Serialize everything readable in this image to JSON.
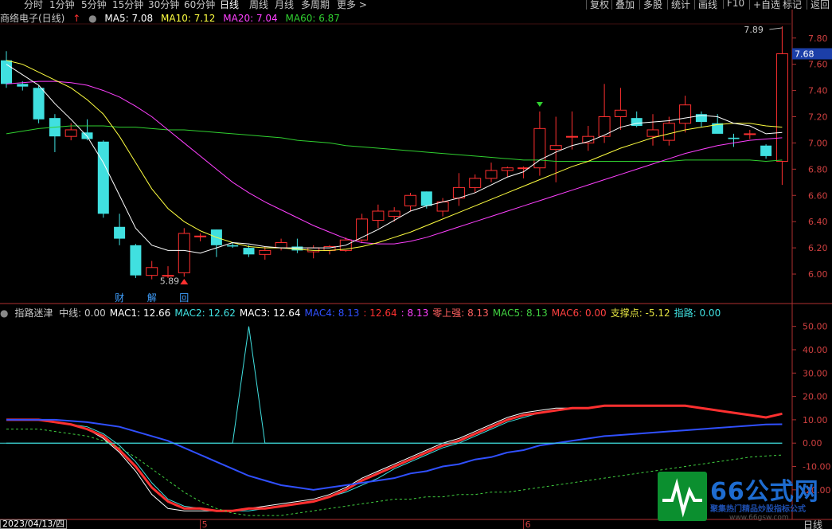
{
  "period_tabs": [
    {
      "label": "分时",
      "x": 30
    },
    {
      "label": "1分钟",
      "x": 62
    },
    {
      "label": "5分钟",
      "x": 102
    },
    {
      "label": "15分钟",
      "x": 141
    },
    {
      "label": "30分钟",
      "x": 186
    },
    {
      "label": "60分钟",
      "x": 231
    },
    {
      "label": "日线",
      "x": 276,
      "active": true
    },
    {
      "label": "周线",
      "x": 313
    },
    {
      "label": "月线",
      "x": 345
    },
    {
      "label": "多周期",
      "x": 378
    },
    {
      "label": "更多 >",
      "x": 423
    }
  ],
  "right_tools": [
    {
      "label": "复权",
      "x": 736
    },
    {
      "label": "叠加",
      "x": 768
    },
    {
      "label": "多股",
      "x": 803
    },
    {
      "label": "统计",
      "x": 838
    },
    {
      "label": "画线",
      "x": 872
    },
    {
      "label": "F10",
      "x": 908
    },
    {
      "label": "+自选",
      "x": 941
    },
    {
      "label": "标记",
      "x": 978
    },
    {
      "label": "返回",
      "x": 1013
    }
  ],
  "main_header": {
    "stock": "商络电子(日线)",
    "ma5": "MA5: 7.08",
    "ma10": "MA10: 7.12",
    "ma20": "MA20: 7.04",
    "ma60": "MA60: 6.87"
  },
  "sub_header": {
    "name": "指路迷津",
    "items": [
      {
        "text": "中线: 0.00",
        "color": "#c8c8c8"
      },
      {
        "text": "MAC1: 12.66",
        "color": "#ffffff"
      },
      {
        "text": "MAC2: 12.62",
        "color": "#40e0e0"
      },
      {
        "text": "MAC3: 12.64",
        "color": "#ffffff"
      },
      {
        "text": "MAC4: 8.13",
        "color": "#3050ff"
      },
      {
        "text": ": 12.64",
        "color": "#ff3030"
      },
      {
        "text": ": 8.13",
        "color": "#ff40ff"
      },
      {
        "text": "零上强: 8.13",
        "color": "#ff6060"
      },
      {
        "text": "MAC5: 8.13",
        "color": "#40d040"
      },
      {
        "text": "MAC6: 0.00",
        "color": "#ff4040"
      },
      {
        "text": "支撑点: -5.12",
        "color": "#e0e040"
      },
      {
        "text": "指路: 0.00",
        "color": "#40e0e0"
      }
    ]
  },
  "colors": {
    "up": "#ff3030",
    "down": "#40e0e0",
    "ma5": "#ffffff",
    "ma10": "#ffff40",
    "ma20": "#ff40ff",
    "ma60": "#30d030",
    "axis": "#b03030"
  },
  "chart_data": [
    {
      "type": "candlestick",
      "title": "商络电子(日线)",
      "y_ticks": [
        "7.80",
        "7.60",
        "7.40",
        "7.20",
        "7.00",
        "6.80",
        "6.60",
        "6.40",
        "6.20",
        "6.00"
      ],
      "ylim": [
        5.83,
        7.92
      ],
      "current_price": "7.68",
      "high_label": "7.89",
      "low_label": "5.89",
      "candles": [
        {
          "o": 7.63,
          "h": 7.7,
          "l": 7.42,
          "c": 7.45
        },
        {
          "o": 7.45,
          "h": 7.47,
          "l": 7.4,
          "c": 7.43
        },
        {
          "o": 7.42,
          "h": 7.44,
          "l": 7.15,
          "c": 7.18
        },
        {
          "o": 7.19,
          "h": 7.22,
          "l": 6.93,
          "c": 7.05
        },
        {
          "o": 7.05,
          "h": 7.15,
          "l": 7.02,
          "c": 7.1
        },
        {
          "o": 7.08,
          "h": 7.18,
          "l": 7.02,
          "c": 7.03
        },
        {
          "o": 7.01,
          "h": 7.02,
          "l": 6.43,
          "c": 6.46
        },
        {
          "o": 6.36,
          "h": 6.46,
          "l": 6.22,
          "c": 6.27
        },
        {
          "o": 6.22,
          "h": 6.23,
          "l": 5.97,
          "c": 5.99
        },
        {
          "o": 5.99,
          "h": 6.1,
          "l": 5.96,
          "c": 6.05
        },
        {
          "o": 5.99,
          "h": 6.06,
          "l": 5.97,
          "c": 5.99
        },
        {
          "o": 6.01,
          "h": 6.35,
          "l": 5.98,
          "c": 6.31
        },
        {
          "o": 6.29,
          "h": 6.31,
          "l": 6.25,
          "c": 6.29
        },
        {
          "o": 6.34,
          "h": 6.34,
          "l": 6.13,
          "c": 6.22
        },
        {
          "o": 6.22,
          "h": 6.24,
          "l": 6.2,
          "c": 6.21
        },
        {
          "o": 6.2,
          "h": 6.22,
          "l": 6.13,
          "c": 6.15
        },
        {
          "o": 6.15,
          "h": 6.21,
          "l": 6.11,
          "c": 6.18
        },
        {
          "o": 6.2,
          "h": 6.27,
          "l": 6.18,
          "c": 6.24
        },
        {
          "o": 6.21,
          "h": 6.27,
          "l": 6.16,
          "c": 6.18
        },
        {
          "o": 6.17,
          "h": 6.22,
          "l": 6.12,
          "c": 6.2
        },
        {
          "o": 6.18,
          "h": 6.22,
          "l": 6.15,
          "c": 6.21
        },
        {
          "o": 6.18,
          "h": 6.28,
          "l": 6.17,
          "c": 6.26
        },
        {
          "o": 6.26,
          "h": 6.46,
          "l": 6.24,
          "c": 6.42
        },
        {
          "o": 6.41,
          "h": 6.53,
          "l": 6.35,
          "c": 6.48
        },
        {
          "o": 6.44,
          "h": 6.51,
          "l": 6.4,
          "c": 6.48
        },
        {
          "o": 6.52,
          "h": 6.62,
          "l": 6.48,
          "c": 6.6
        },
        {
          "o": 6.63,
          "h": 6.63,
          "l": 6.5,
          "c": 6.52
        },
        {
          "o": 6.48,
          "h": 6.58,
          "l": 6.44,
          "c": 6.55
        },
        {
          "o": 6.58,
          "h": 6.77,
          "l": 6.52,
          "c": 6.66
        },
        {
          "o": 6.66,
          "h": 6.76,
          "l": 6.62,
          "c": 6.73
        },
        {
          "o": 6.73,
          "h": 6.85,
          "l": 6.7,
          "c": 6.79
        },
        {
          "o": 6.79,
          "h": 6.82,
          "l": 6.74,
          "c": 6.81
        },
        {
          "o": 6.81,
          "h": 6.82,
          "l": 6.73,
          "c": 6.81
        },
        {
          "o": 6.81,
          "h": 7.24,
          "l": 6.75,
          "c": 7.11
        },
        {
          "o": 6.95,
          "h": 7.2,
          "l": 6.7,
          "c": 6.98
        },
        {
          "o": 7.05,
          "h": 7.24,
          "l": 6.95,
          "c": 7.05
        },
        {
          "o": 7.0,
          "h": 7.13,
          "l": 6.94,
          "c": 7.05
        },
        {
          "o": 7.05,
          "h": 7.45,
          "l": 7.0,
          "c": 7.2
        },
        {
          "o": 7.2,
          "h": 7.42,
          "l": 7.1,
          "c": 7.25
        },
        {
          "o": 7.19,
          "h": 7.24,
          "l": 7.12,
          "c": 7.13
        },
        {
          "o": 7.05,
          "h": 7.22,
          "l": 6.98,
          "c": 7.1
        },
        {
          "o": 7.02,
          "h": 7.2,
          "l": 6.98,
          "c": 7.15
        },
        {
          "o": 7.15,
          "h": 7.36,
          "l": 7.08,
          "c": 7.29
        },
        {
          "o": 7.22,
          "h": 7.24,
          "l": 7.12,
          "c": 7.16
        },
        {
          "o": 7.15,
          "h": 7.22,
          "l": 7.08,
          "c": 7.07
        },
        {
          "o": 7.04,
          "h": 7.07,
          "l": 6.97,
          "c": 7.03
        },
        {
          "o": 7.07,
          "h": 7.1,
          "l": 7.03,
          "c": 7.07
        },
        {
          "o": 6.98,
          "h": 6.99,
          "l": 6.88,
          "c": 6.9
        },
        {
          "o": 6.86,
          "h": 7.89,
          "l": 6.68,
          "c": 7.68
        }
      ],
      "ma5": [
        7.6,
        7.52,
        7.44,
        7.3,
        7.18,
        7.05,
        6.85,
        6.6,
        6.35,
        6.22,
        6.18,
        6.18,
        6.16,
        6.2,
        6.24,
        6.23,
        6.21,
        6.2,
        6.2,
        6.2,
        6.2,
        6.22,
        6.28,
        6.34,
        6.41,
        6.48,
        6.52,
        6.55,
        6.58,
        6.62,
        6.68,
        6.74,
        6.78,
        6.87,
        6.93,
        6.98,
        7.01,
        7.06,
        7.12,
        7.15,
        7.16,
        7.17,
        7.19,
        7.21,
        7.2,
        7.15,
        7.13,
        7.07,
        7.08
      ],
      "ma10": [
        7.63,
        7.6,
        7.54,
        7.48,
        7.42,
        7.33,
        7.22,
        7.05,
        6.85,
        6.65,
        6.5,
        6.4,
        6.33,
        6.28,
        6.24,
        6.21,
        6.2,
        6.2,
        6.19,
        6.18,
        6.18,
        6.19,
        6.21,
        6.24,
        6.28,
        6.32,
        6.37,
        6.42,
        6.47,
        6.52,
        6.57,
        6.62,
        6.67,
        6.72,
        6.77,
        6.82,
        6.86,
        6.91,
        6.96,
        7.0,
        7.04,
        7.07,
        7.1,
        7.12,
        7.14,
        7.15,
        7.15,
        7.13,
        7.12
      ],
      "ma20": [
        7.45,
        7.46,
        7.47,
        7.47,
        7.46,
        7.44,
        7.4,
        7.35,
        7.28,
        7.2,
        7.1,
        7.0,
        6.9,
        6.8,
        6.7,
        6.62,
        6.55,
        6.49,
        6.43,
        6.37,
        6.32,
        6.27,
        6.24,
        6.23,
        6.23,
        6.25,
        6.28,
        6.32,
        6.36,
        6.4,
        6.44,
        6.48,
        6.52,
        6.56,
        6.6,
        6.64,
        6.68,
        6.72,
        6.76,
        6.8,
        6.84,
        6.88,
        6.92,
        6.95,
        6.98,
        7.0,
        7.02,
        7.03,
        7.04
      ],
      "ma60": [
        7.07,
        7.09,
        7.11,
        7.12,
        7.13,
        7.13,
        7.13,
        7.12,
        7.12,
        7.11,
        7.1,
        7.1,
        7.09,
        7.08,
        7.07,
        7.06,
        7.05,
        7.04,
        7.02,
        7.01,
        7.0,
        6.98,
        6.97,
        6.96,
        6.95,
        6.94,
        6.93,
        6.92,
        6.91,
        6.9,
        6.89,
        6.88,
        6.87,
        6.87,
        6.86,
        6.86,
        6.86,
        6.86,
        6.86,
        6.86,
        6.86,
        6.86,
        6.87,
        6.87,
        6.87,
        6.87,
        6.87,
        6.86,
        6.87
      ],
      "markers": [
        {
          "label": "财",
          "index": 7
        },
        {
          "label": "解",
          "index": 9
        },
        {
          "label": "回",
          "index": 11
        }
      ]
    },
    {
      "type": "line",
      "title": "指路迷津",
      "y_ticks": [
        "50.00",
        "40.00",
        "30.00",
        "20.00",
        "10.00",
        "0.00",
        "-10.00",
        "-20.00"
      ],
      "ylim": [
        -32,
        55
      ],
      "x_ticks": [
        {
          "label": "5",
          "index": 12
        },
        {
          "label": "6",
          "index": 32
        }
      ],
      "start_date": "2023/04/13/四",
      "series": [
        {
          "name": "MAC1",
          "color": "#ffffff",
          "values": [
            10,
            10,
            10,
            9,
            8,
            6,
            2,
            -4,
            -12,
            -22,
            -28,
            -29,
            -29,
            -29,
            -29,
            -28,
            -27,
            -26,
            -25,
            -24,
            -22,
            -19,
            -15,
            -12,
            -9,
            -6,
            -3,
            0,
            2,
            5,
            8,
            11,
            13,
            14,
            15,
            15,
            15,
            16,
            16,
            16,
            16,
            16,
            16,
            15,
            14,
            13,
            12,
            11,
            12.7
          ]
        },
        {
          "name": "MAC2",
          "color": "#40e0e0",
          "values": [
            10,
            10,
            10,
            9,
            8,
            7,
            4,
            -1,
            -8,
            -17,
            -24,
            -27,
            -28,
            -29,
            -29,
            -29,
            -28,
            -27,
            -26,
            -25,
            -23,
            -21,
            -18,
            -15,
            -11,
            -8,
            -5,
            -2,
            0,
            3,
            6,
            9,
            11,
            13,
            14,
            15,
            15,
            16,
            16,
            16,
            16,
            16,
            16,
            15,
            14,
            13,
            12,
            11,
            12.6
          ]
        },
        {
          "name": "MAC3",
          "color": "#ff3030",
          "values": [
            10,
            10,
            10,
            9,
            8,
            6,
            3,
            -3,
            -10,
            -19,
            -25,
            -28,
            -28,
            -29,
            -29,
            -28,
            -28,
            -27,
            -26,
            -25,
            -23,
            -20,
            -16,
            -13,
            -10,
            -7,
            -4,
            -1,
            1,
            4,
            7,
            10,
            12,
            13,
            14,
            15,
            15,
            16,
            16,
            16,
            16,
            16,
            16,
            15,
            14,
            13,
            12,
            11,
            12.6
          ]
        },
        {
          "name": "MAC4",
          "color": "#3050ff",
          "values": [
            10,
            10,
            10,
            10,
            9.5,
            9,
            8,
            7,
            5,
            3,
            1,
            -2,
            -5,
            -8,
            -11,
            -14,
            -16,
            -18,
            -19,
            -20,
            -19,
            -18,
            -17,
            -16,
            -15,
            -13,
            -12,
            -10,
            -9,
            -7,
            -6,
            -4,
            -3,
            -1,
            0,
            1,
            2,
            3,
            3.5,
            4,
            4.5,
            5,
            5.5,
            6,
            6.5,
            7,
            7.5,
            8,
            8.1
          ]
        },
        {
          "name": "MAC5",
          "color": "#40d040",
          "dashed": true,
          "values": [
            6,
            6,
            6,
            5,
            4,
            3,
            1,
            -2,
            -6,
            -11,
            -16,
            -21,
            -25,
            -28,
            -30,
            -31,
            -31,
            -31,
            -30,
            -29,
            -28,
            -27,
            -26,
            -25,
            -24,
            -24,
            -23,
            -23,
            -22,
            -22,
            -21,
            -21,
            -20,
            -19,
            -18,
            -17,
            -16,
            -15,
            -14,
            -13,
            -12,
            -11,
            -10,
            -9,
            -8,
            -7,
            -6,
            -5.5,
            -5.1
          ]
        },
        {
          "name": "指路",
          "color": "#40e0e0",
          "values": [
            0,
            0,
            0,
            0,
            0,
            0,
            0,
            0,
            0,
            0,
            0,
            0,
            0,
            0,
            0,
            50,
            0,
            0,
            0,
            0,
            0,
            0,
            0,
            0,
            0,
            0,
            0,
            0,
            0,
            0,
            0,
            0,
            0,
            0,
            0,
            0,
            0,
            0,
            0,
            0,
            0,
            0,
            0,
            0,
            0,
            0,
            0,
            0,
            0
          ]
        }
      ]
    }
  ],
  "logo": {
    "title": "66公式网",
    "subtitle": "聚集热门精品炒股指标公式",
    "url": "www.66gsw.com"
  },
  "period_corner": "日线"
}
